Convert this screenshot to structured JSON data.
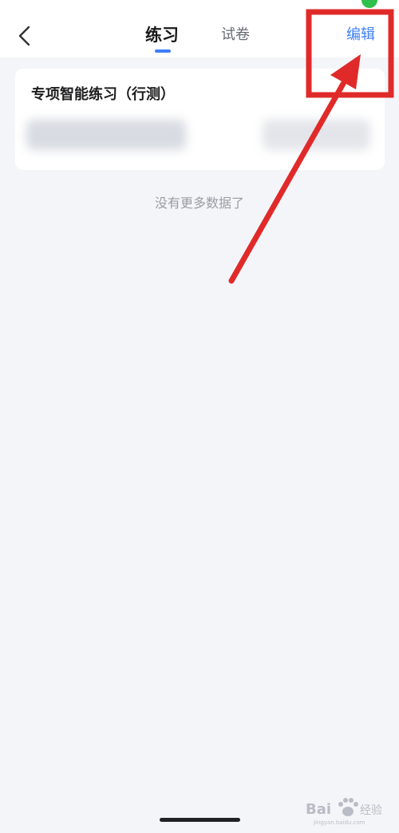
{
  "header": {
    "tabs": [
      {
        "label": "练习",
        "active": true
      },
      {
        "label": "试卷",
        "active": false
      }
    ],
    "edit_label": "编辑"
  },
  "card": {
    "title": "专项智能练习（行测）"
  },
  "empty_state": {
    "text": "没有更多数据了"
  },
  "colors": {
    "accent": "#3d7ff5",
    "annotation": "#e02a2a",
    "background": "#f4f5f9",
    "status_dot": "#2fbf4a"
  },
  "icons": {
    "back": "chevron-left-icon",
    "watermark": "baidu-paw-logo"
  },
  "watermark_text": "Baidu 经验"
}
